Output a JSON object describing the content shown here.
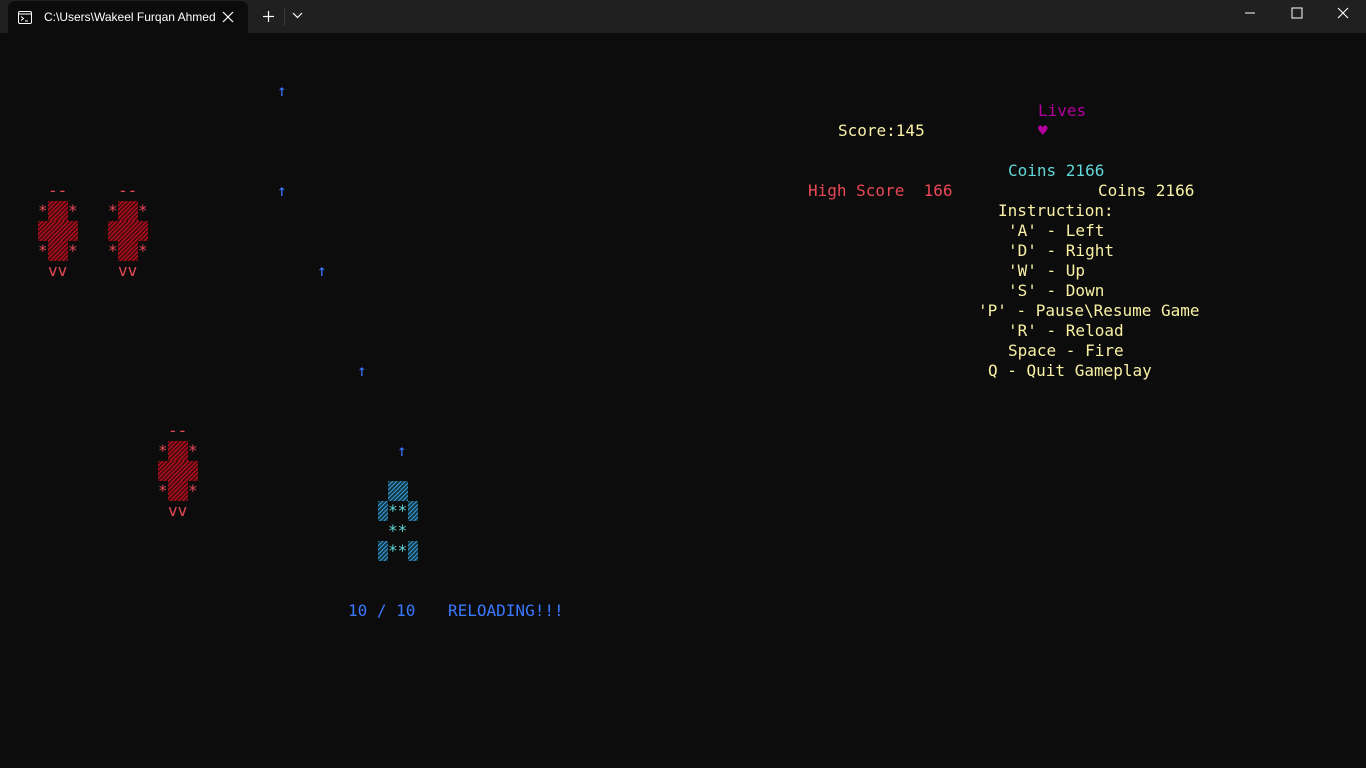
{
  "window": {
    "tab_title": "C:\\Users\\Wakeel Furqan Ahmed",
    "icons": [
      "terminal-icon",
      "close-icon",
      "plus-icon",
      "chevron-down-icon",
      "minimize-icon",
      "maximize-icon",
      "window-close-icon"
    ]
  },
  "hud": {
    "lives_label": "Lives",
    "lives_heart": "♥",
    "score_label": "Score:145",
    "coins_top": "Coins 2166",
    "high_score": "High Score  166",
    "coins_right": "Coins 2166",
    "instruction_title": "Instruction:",
    "instructions": [
      "'A' - Left",
      "'D' - Right",
      "'W' - Up",
      "'S' - Down",
      "'P' - Pause\\Resume Game",
      "'R' - Reload",
      "Space - Fire",
      "Q - Quit Gameplay"
    ]
  },
  "ammo": {
    "count": "10 / 10",
    "status": "RELOADING!!!"
  },
  "sprites": {
    "bullet": "↑",
    "enemy_top": "--",
    "enemy_star": "*",
    "enemy_bottom": "vv",
    "player_stars": "**"
  },
  "colors": {
    "background": "#0c0c0c",
    "hud_text": "#f9f1a5",
    "high_score": "#e74856",
    "lives": "#b4009e",
    "coins": "#61d6d6",
    "ammo": "#3b78ff",
    "enemy": "#e74856",
    "player": "#61d6d6"
  }
}
